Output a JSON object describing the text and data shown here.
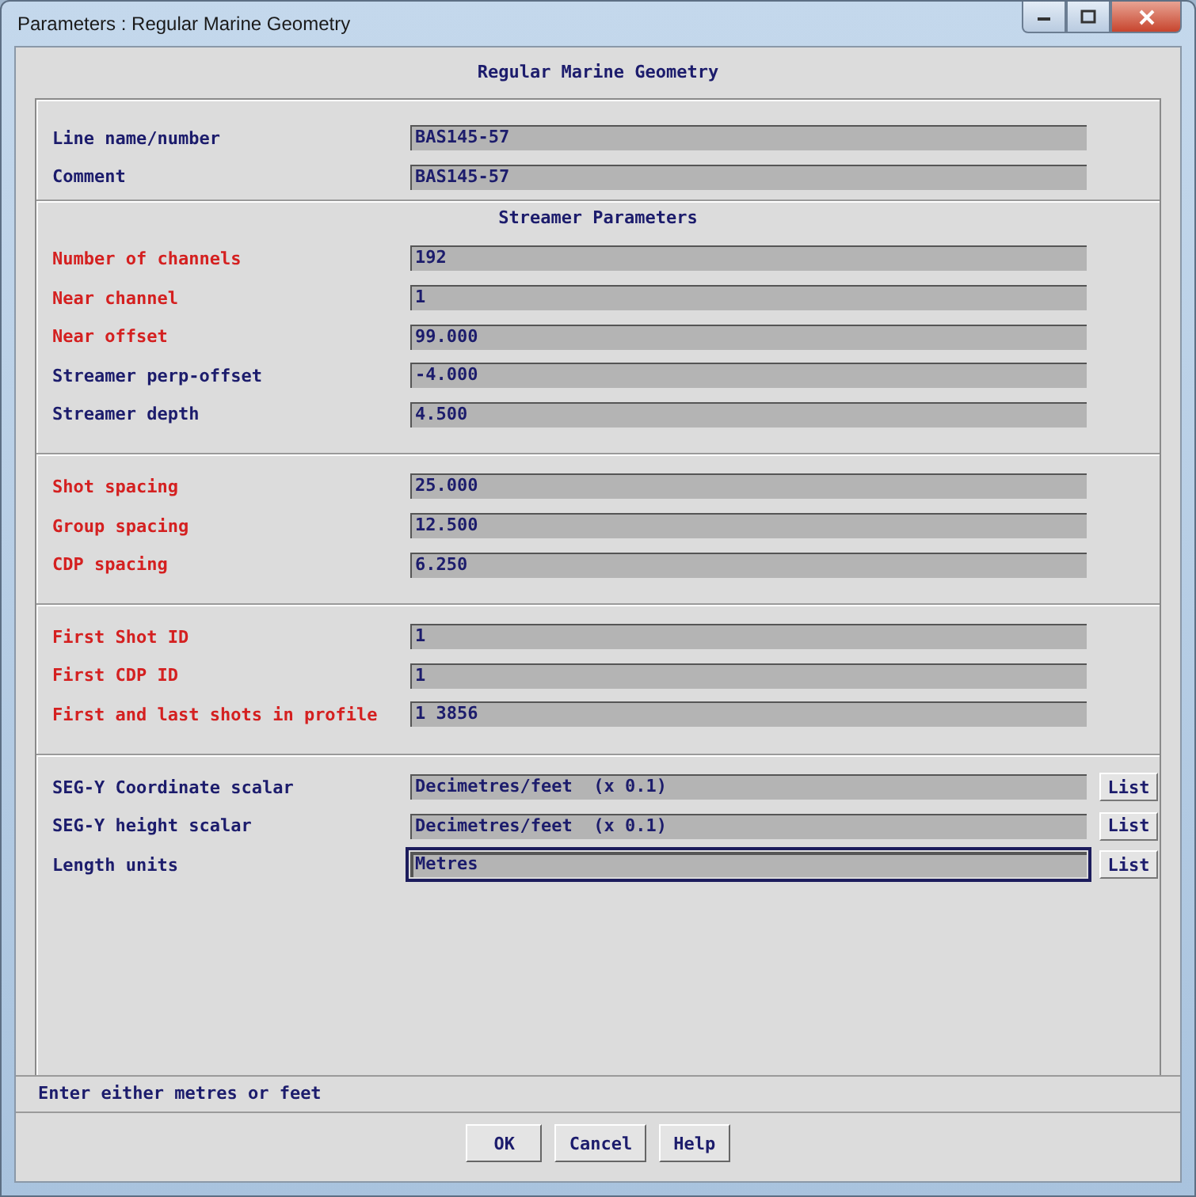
{
  "window": {
    "title": "Parameters : Regular Marine Geometry"
  },
  "dialog_title": "Regular Marine Geometry",
  "sections": [
    {
      "rows": [
        {
          "label": "Line name/number",
          "value": "BAS145-57",
          "required": false,
          "focused": false
        },
        {
          "label": "Comment",
          "value": "BAS145-57",
          "required": false,
          "focused": false
        }
      ]
    },
    {
      "heading": "Streamer Parameters",
      "rows": [
        {
          "label": "Number of channels",
          "value": "192",
          "required": true,
          "focused": false
        },
        {
          "label": "Near channel",
          "value": "1",
          "required": true,
          "focused": false
        },
        {
          "label": "Near offset",
          "value": "99.000",
          "required": true,
          "focused": false
        },
        {
          "label": "Streamer perp-offset",
          "value": "-4.000",
          "required": false,
          "focused": false
        },
        {
          "label": "Streamer depth",
          "value": "4.500",
          "required": false,
          "focused": false
        }
      ]
    },
    {
      "rows": [
        {
          "label": "Shot spacing",
          "value": "25.000",
          "required": true,
          "focused": false
        },
        {
          "label": "Group spacing",
          "value": "12.500",
          "required": true,
          "focused": false
        },
        {
          "label": "CDP spacing",
          "value": "6.250",
          "required": true,
          "focused": false
        }
      ]
    },
    {
      "rows": [
        {
          "label": "First Shot ID",
          "value": "1",
          "required": true,
          "focused": false
        },
        {
          "label": "First CDP ID",
          "value": "1",
          "required": true,
          "focused": false
        },
        {
          "label": "First and last shots in profile",
          "value": "1 3856",
          "required": true,
          "focused": false
        }
      ]
    },
    {
      "rows": [
        {
          "label": "SEG-Y Coordinate scalar",
          "value": "Decimetres/feet  (x 0.1)",
          "required": false,
          "focused": false,
          "list_button": "List"
        },
        {
          "label": "SEG-Y height scalar",
          "value": "Decimetres/feet  (x 0.1)",
          "required": false,
          "focused": false,
          "list_button": "List"
        },
        {
          "label": "Length units",
          "value": "Metres",
          "required": false,
          "focused": true,
          "list_button": "List"
        }
      ]
    }
  ],
  "status_message": "Enter either metres or feet",
  "buttons": [
    "OK",
    "Cancel",
    "Help"
  ]
}
